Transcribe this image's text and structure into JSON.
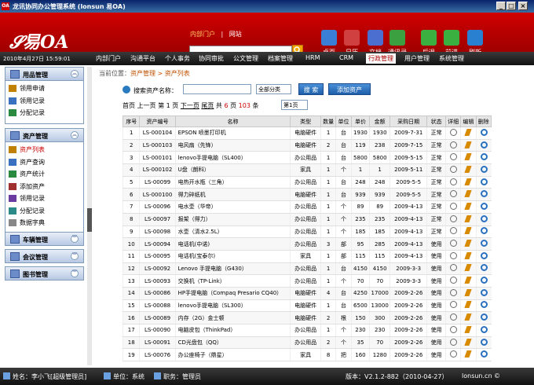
{
  "window": {
    "title": "龙讯协同办公管理系统 (lonsun 易OA)"
  },
  "header": {
    "logo": "易OA",
    "nav": [
      "内部门户",
      "网站"
    ],
    "nav_sep": "|",
    "icons": [
      {
        "label": "桌面",
        "icon": "desktop-icon",
        "color": "#3a7fd5"
      },
      {
        "label": "日历",
        "icon": "calendar-icon",
        "color": "#d04040"
      },
      {
        "label": "文档",
        "icon": "document-icon",
        "color": "#4a6fd0"
      },
      {
        "label": "通讯录",
        "icon": "address-book-icon",
        "color": "#3aa040"
      },
      {
        "label": "后退",
        "icon": "back-icon",
        "color": "#3ab040"
      },
      {
        "label": "前进",
        "icon": "forward-icon",
        "color": "#3ab040"
      },
      {
        "label": "刷新",
        "icon": "refresh-icon",
        "color": "#2a80d0"
      }
    ]
  },
  "menubar": {
    "datetime": "2010年4月27日 15:59:01",
    "items": [
      "内部门户",
      "沟通平台",
      "个人事务",
      "协同审批",
      "公文管理",
      "档案管理",
      "HRM",
      "CRM",
      "行政管理",
      "用户管理",
      "系统管理"
    ],
    "active": "行政管理"
  },
  "sidebar": {
    "panels": [
      {
        "title": "用品管理",
        "items": [
          "领用申请",
          "领用记录",
          "分配记录"
        ]
      },
      {
        "title": "资产管理",
        "items": [
          "资产列表",
          "资产查询",
          "资产统计",
          "添加资产",
          "领用记录",
          "分配记录",
          "数据字典"
        ],
        "active": "资产列表"
      },
      {
        "title": "车辆管理",
        "items": []
      },
      {
        "title": "会议管理",
        "items": []
      },
      {
        "title": "图书管理",
        "items": []
      }
    ]
  },
  "main": {
    "breadcrumb": {
      "prefix": "当前位置：",
      "path": "资产管理 > 资产列表"
    },
    "search": {
      "label": "搜索资产名称：",
      "value": "",
      "category": "全部分类",
      "search_btn": "搜 索",
      "add_btn": "添加资产"
    },
    "pager": {
      "first": "首页",
      "prev": "上一页",
      "page_prefix": "第",
      "page": "1",
      "page_suffix": "页",
      "next": "下一页",
      "last": "尾页",
      "total_prefix": "共",
      "pages": "6",
      "pages_suffix": "页",
      "count": "103",
      "count_suffix": "条",
      "select": "第1页"
    },
    "columns": [
      "序号",
      "资产编号",
      "名称",
      "类型",
      "数量",
      "单位",
      "单价",
      "金额",
      "采购日期",
      "状态",
      "详细",
      "编辑",
      "删除"
    ],
    "rows": [
      [
        "1",
        "LS-000104",
        "EPSON 喷墨打印机",
        "电脑硬件",
        "1",
        "台",
        "1930",
        "1930",
        "2009-7-31",
        "正常"
      ],
      [
        "2",
        "LS-000103",
        "电风扇（先锋）",
        "电脑硬件",
        "2",
        "台",
        "119",
        "238",
        "2009-7-15",
        "正常"
      ],
      [
        "3",
        "LS-000101",
        "lenovo手提电脑（SL400）",
        "办公用品",
        "1",
        "台",
        "5800",
        "5800",
        "2009-5-15",
        "正常"
      ],
      [
        "4",
        "LS-000102",
        "U盘（朗科）",
        "家具",
        "1",
        "个",
        "1",
        "1",
        "2009-5-11",
        "正常"
      ],
      [
        "5",
        "LS-00099",
        "电热开水瓶（三角）",
        "办公用品",
        "1",
        "台",
        "248",
        "248",
        "2009-5-5",
        "正常"
      ],
      [
        "6",
        "LS-000100",
        "得力碎纸机",
        "电脑硬件",
        "1",
        "台",
        "939",
        "939",
        "2009-5-5",
        "正常"
      ],
      [
        "7",
        "LS-00096",
        "电水壶（华帝）",
        "办公用品",
        "1",
        "个",
        "89",
        "89",
        "2009-4-13",
        "正常"
      ],
      [
        "8",
        "LS-00097",
        "报架（得力）",
        "办公用品",
        "1",
        "个",
        "235",
        "235",
        "2009-4-13",
        "正常"
      ],
      [
        "9",
        "LS-00098",
        "水壶（清水2.5L）",
        "办公用品",
        "1",
        "个",
        "185",
        "185",
        "2009-4-13",
        "正常"
      ],
      [
        "10",
        "LS-00094",
        "电话机(中诺)",
        "办公用品",
        "3",
        "部",
        "95",
        "285",
        "2009-4-13",
        "使用"
      ],
      [
        "11",
        "LS-00095",
        "电话机(宝泰尔)",
        "家具",
        "1",
        "部",
        "115",
        "115",
        "2009-4-13",
        "使用"
      ],
      [
        "12",
        "LS-00092",
        "Lenovo 手提电脑（G430）",
        "办公用品",
        "1",
        "台",
        "4150",
        "4150",
        "2009-3-3",
        "使用"
      ],
      [
        "13",
        "LS-00093",
        "交换机（TP-Link）",
        "办公用品",
        "1",
        "个",
        "70",
        "70",
        "2009-3-3",
        "使用"
      ],
      [
        "14",
        "LS-00086",
        "HP手提电脑（Compaq Presario CQ40）",
        "电脑硬件",
        "4",
        "台",
        "4250",
        "17000",
        "2009-2-26",
        "使用"
      ],
      [
        "15",
        "LS-00088",
        "lenovo手提电脑（SL300）",
        "电脑硬件",
        "1",
        "台",
        "6500",
        "13000",
        "2009-2-26",
        "使用"
      ],
      [
        "16",
        "LS-00089",
        "内存（2G）金士顿",
        "电脑硬件",
        "2",
        "根",
        "150",
        "300",
        "2009-2-26",
        "使用"
      ],
      [
        "17",
        "LS-00090",
        "电脑皮包（ThinkPad）",
        "办公用品",
        "1",
        "个",
        "230",
        "230",
        "2009-2-26",
        "使用"
      ],
      [
        "18",
        "LS-00091",
        "CD光盘包（QQ）",
        "办公用品",
        "2",
        "个",
        "35",
        "70",
        "2009-2-26",
        "使用"
      ],
      [
        "19",
        "LS-00076",
        "办公座椅子（鼎星）",
        "家具",
        "8",
        "把",
        "160",
        "1280",
        "2009-2-26",
        "使用"
      ]
    ]
  },
  "statusbar": {
    "user": "姓名：李小飞[超级管理员]",
    "unit": "单位：系统",
    "position": "职务：管理员",
    "version": "版本：V2.1.2-882（2010-04-27）",
    "brand": "lonsun.cn ©"
  }
}
